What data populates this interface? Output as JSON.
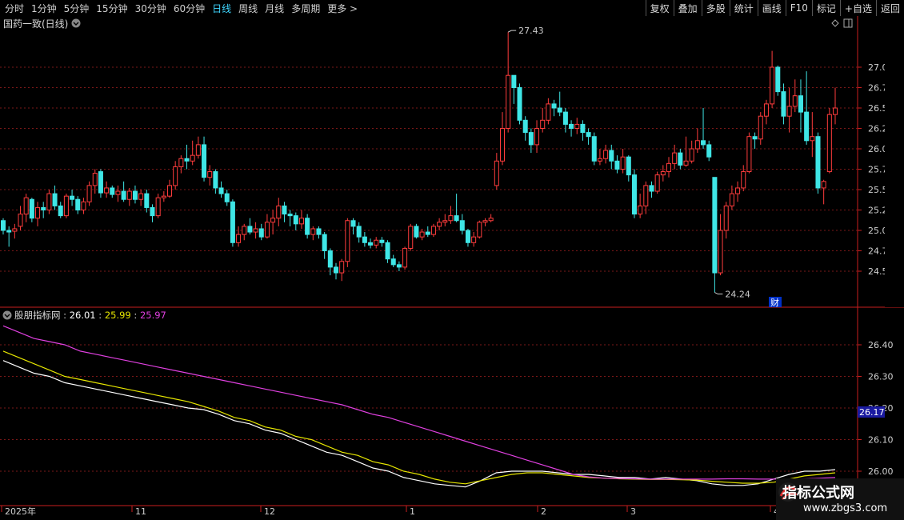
{
  "toolbar": {
    "periods": [
      "分时",
      "1分钟",
      "5分钟",
      "15分钟",
      "30分钟",
      "60分钟",
      "日线",
      "周线",
      "月线",
      "多周期",
      "更多 >"
    ],
    "active_period": "日线",
    "actions": [
      "复权",
      "叠加",
      "多股",
      "统计",
      "画线",
      "F10",
      "标记",
      "+自选",
      "返回"
    ]
  },
  "main_title": "国药一致(日线)",
  "indicator": {
    "name": "股朋指标网",
    "v1": "26.01",
    "v2": "25.99",
    "v3": "25.97",
    "sep": " : "
  },
  "annotations": {
    "high": "27.43",
    "low": "24.24",
    "cai": "财",
    "last_value": "26.17"
  },
  "x_axis_labels": [
    "2025年",
    "11",
    "12",
    "1",
    "2",
    "3",
    "4"
  ],
  "price_axis": [
    "27.00",
    "26.75",
    "26.50",
    "26.25",
    "26.00",
    "25.75",
    "25.50",
    "25.25",
    "25.00",
    "24.75",
    "24.50"
  ],
  "indicator_axis": [
    "26.40",
    "26.30",
    "26.20",
    "26.10",
    "26.00"
  ],
  "colors": {
    "up": "#ff3c3c",
    "down": "#3fe6e6",
    "line_white": "#ffffff",
    "line_yellow": "#e6e600",
    "line_magenta": "#e040e0",
    "grid": "#8b1c1c",
    "axis": "#c81e1e"
  },
  "watermark": {
    "title": "指标公式网",
    "url": "www.zbgs3.com"
  },
  "chart_data": {
    "type": "candlestick",
    "candles": [
      [
        25.12,
        25.0,
        25.15,
        24.95
      ],
      [
        25.0,
        24.98,
        25.05,
        24.8
      ],
      [
        24.99,
        25.02,
        25.08,
        24.9
      ],
      [
        25.05,
        25.2,
        25.3,
        25.0
      ],
      [
        25.2,
        25.4,
        25.45,
        25.1
      ],
      [
        25.38,
        25.15,
        25.4,
        25.1
      ],
      [
        25.15,
        25.28,
        25.35,
        25.05
      ],
      [
        25.28,
        25.25,
        25.35,
        25.15
      ],
      [
        25.25,
        25.45,
        25.5,
        25.2
      ],
      [
        25.45,
        25.3,
        25.55,
        25.25
      ],
      [
        25.3,
        25.18,
        25.35,
        25.15
      ],
      [
        25.18,
        25.42,
        25.45,
        25.15
      ],
      [
        25.42,
        25.38,
        25.5,
        25.3
      ],
      [
        25.38,
        25.25,
        25.42,
        25.2
      ],
      [
        25.25,
        25.35,
        25.4,
        25.2
      ],
      [
        25.35,
        25.55,
        25.6,
        25.3
      ],
      [
        25.55,
        25.7,
        25.75,
        25.45
      ],
      [
        25.72,
        25.46,
        25.75,
        25.4
      ],
      [
        25.46,
        25.52,
        25.6,
        25.4
      ],
      [
        25.52,
        25.44,
        25.55,
        25.4
      ],
      [
        25.44,
        25.48,
        25.55,
        25.35
      ],
      [
        25.48,
        25.38,
        25.6,
        25.35
      ],
      [
        25.38,
        25.48,
        25.52,
        25.3
      ],
      [
        25.48,
        25.38,
        25.55,
        25.33
      ],
      [
        25.38,
        25.45,
        25.5,
        25.3
      ],
      [
        25.45,
        25.28,
        25.5,
        25.22
      ],
      [
        25.28,
        25.18,
        25.32,
        25.1
      ],
      [
        25.18,
        25.4,
        25.45,
        25.15
      ],
      [
        25.4,
        25.42,
        25.48,
        25.35
      ],
      [
        25.42,
        25.55,
        25.62,
        25.4
      ],
      [
        25.55,
        25.78,
        25.85,
        25.5
      ],
      [
        25.78,
        25.88,
        25.92,
        25.7
      ],
      [
        25.88,
        25.85,
        26.05,
        25.75
      ],
      [
        25.85,
        25.92,
        26.1,
        25.8
      ],
      [
        25.92,
        26.05,
        26.15,
        25.88
      ],
      [
        26.05,
        25.65,
        26.15,
        25.6
      ],
      [
        25.65,
        25.72,
        25.8,
        25.55
      ],
      [
        25.72,
        25.52,
        25.75,
        25.45
      ],
      [
        25.52,
        25.45,
        25.6,
        25.4
      ],
      [
        25.45,
        25.35,
        25.5,
        25.3
      ],
      [
        25.35,
        24.85,
        25.38,
        24.8
      ],
      [
        24.85,
        24.95,
        25.05,
        24.8
      ],
      [
        24.95,
        25.05,
        25.08,
        24.88
      ],
      [
        25.05,
        24.98,
        25.15,
        24.95
      ],
      [
        24.98,
        25.02,
        25.1,
        24.9
      ],
      [
        25.02,
        24.92,
        25.08,
        24.88
      ],
      [
        24.92,
        25.1,
        25.2,
        24.9
      ],
      [
        25.1,
        25.15,
        25.25,
        24.95
      ],
      [
        25.15,
        25.3,
        25.4,
        25.05
      ],
      [
        25.3,
        25.2,
        25.35,
        25.1
      ],
      [
        25.2,
        25.18,
        25.25,
        25.05
      ],
      [
        25.18,
        25.08,
        25.22,
        25.0
      ],
      [
        25.08,
        25.15,
        25.25,
        25.02
      ],
      [
        25.15,
        24.95,
        25.2,
        24.9
      ],
      [
        24.95,
        25.02,
        25.05,
        24.88
      ],
      [
        25.02,
        24.95,
        25.05,
        24.9
      ],
      [
        24.95,
        24.75,
        24.98,
        24.65
      ],
      [
        24.75,
        24.55,
        24.78,
        24.45
      ],
      [
        24.55,
        24.48,
        24.6,
        24.4
      ],
      [
        24.48,
        24.62,
        24.65,
        24.38
      ],
      [
        24.62,
        25.12,
        25.15,
        24.55
      ],
      [
        25.12,
        25.05,
        25.15,
        24.95
      ],
      [
        25.05,
        24.92,
        25.1,
        24.85
      ],
      [
        24.92,
        24.85,
        24.98,
        24.8
      ],
      [
        24.85,
        24.82,
        24.9,
        24.78
      ],
      [
        24.82,
        24.88,
        24.92,
        24.78
      ],
      [
        24.88,
        24.85,
        24.92,
        24.8
      ],
      [
        24.85,
        24.65,
        24.88,
        24.6
      ],
      [
        24.65,
        24.58,
        24.7,
        24.55
      ],
      [
        24.58,
        24.55,
        24.62,
        24.5
      ],
      [
        24.55,
        24.78,
        24.8,
        24.52
      ],
      [
        24.78,
        25.05,
        25.08,
        24.75
      ],
      [
        25.05,
        24.92,
        25.08,
        24.9
      ],
      [
        24.92,
        24.98,
        25.02,
        24.88
      ],
      [
        24.98,
        24.95,
        25.05,
        24.92
      ],
      [
        24.95,
        25.05,
        25.08,
        24.92
      ],
      [
        25.05,
        25.1,
        25.15,
        25.0
      ],
      [
        25.1,
        25.12,
        25.2,
        25.05
      ],
      [
        25.12,
        25.18,
        25.3,
        25.08
      ],
      [
        25.18,
        25.12,
        25.45,
        25.1
      ],
      [
        25.12,
        25.0,
        25.2,
        24.95
      ],
      [
        25.0,
        24.85,
        25.02,
        24.8
      ],
      [
        24.85,
        24.92,
        24.98,
        24.8
      ],
      [
        24.92,
        25.1,
        25.12,
        24.9
      ],
      [
        25.1,
        25.12,
        25.15,
        25.05
      ],
      [
        25.12,
        25.15,
        25.2,
        25.1
      ],
      [
        25.55,
        25.85,
        25.95,
        25.5
      ],
      [
        25.85,
        26.25,
        26.45,
        25.8
      ],
      [
        26.25,
        26.9,
        27.43,
        26.2
      ],
      [
        26.9,
        26.75,
        26.9,
        26.55
      ],
      [
        26.75,
        26.35,
        26.8,
        26.3
      ],
      [
        26.35,
        26.2,
        26.4,
        26.1
      ],
      [
        26.2,
        26.05,
        26.25,
        25.95
      ],
      [
        26.05,
        26.25,
        26.35,
        25.95
      ],
      [
        26.25,
        26.35,
        26.5,
        26.2
      ],
      [
        26.35,
        26.55,
        26.62,
        26.3
      ],
      [
        26.55,
        26.5,
        26.6,
        26.4
      ],
      [
        26.5,
        26.45,
        26.7,
        26.4
      ],
      [
        26.45,
        26.3,
        26.5,
        26.2
      ],
      [
        26.3,
        26.25,
        26.35,
        26.15
      ],
      [
        26.25,
        26.3,
        26.38,
        26.18
      ],
      [
        26.3,
        26.2,
        26.35,
        26.1
      ],
      [
        26.2,
        26.15,
        26.25,
        26.05
      ],
      [
        26.15,
        25.85,
        26.2,
        25.8
      ],
      [
        25.85,
        25.88,
        26.0,
        25.8
      ],
      [
        25.88,
        25.98,
        26.05,
        25.82
      ],
      [
        25.98,
        25.85,
        26.05,
        25.75
      ],
      [
        25.85,
        25.75,
        25.92,
        25.7
      ],
      [
        25.75,
        25.9,
        26.0,
        25.7
      ],
      [
        25.9,
        25.68,
        25.92,
        25.6
      ],
      [
        25.68,
        25.2,
        25.75,
        25.15
      ],
      [
        25.2,
        25.3,
        25.45,
        25.15
      ],
      [
        25.3,
        25.55,
        25.6,
        25.2
      ],
      [
        25.55,
        25.48,
        25.6,
        25.4
      ],
      [
        25.48,
        25.68,
        25.72,
        25.45
      ],
      [
        25.68,
        25.72,
        25.8,
        25.6
      ],
      [
        25.72,
        25.82,
        25.9,
        25.65
      ],
      [
        25.82,
        25.95,
        26.05,
        25.75
      ],
      [
        25.95,
        25.8,
        26.0,
        25.75
      ],
      [
        25.8,
        25.85,
        26.15,
        25.78
      ],
      [
        25.85,
        26.0,
        26.1,
        25.82
      ],
      [
        26.0,
        26.1,
        26.25,
        25.95
      ],
      [
        26.1,
        26.05,
        26.5,
        26.0
      ],
      [
        26.05,
        25.9,
        26.1,
        25.85
      ],
      [
        25.65,
        24.48,
        25.65,
        24.24
      ],
      [
        24.48,
        25.0,
        25.2,
        24.45
      ],
      [
        25.0,
        25.3,
        25.35,
        24.9
      ],
      [
        25.3,
        25.45,
        25.55,
        25.25
      ],
      [
        25.45,
        25.52,
        25.6,
        25.35
      ],
      [
        25.52,
        25.72,
        25.8,
        25.48
      ],
      [
        25.72,
        26.15,
        26.2,
        25.7
      ],
      [
        26.15,
        26.12,
        26.2,
        26.0
      ],
      [
        26.12,
        26.4,
        26.45,
        26.05
      ],
      [
        26.4,
        26.55,
        26.6,
        26.3
      ],
      [
        26.55,
        27.0,
        27.2,
        26.5
      ],
      [
        27.0,
        26.7,
        27.02,
        26.65
      ],
      [
        26.7,
        26.4,
        26.8,
        26.3
      ],
      [
        26.4,
        26.52,
        26.75,
        26.2
      ],
      [
        26.52,
        26.65,
        26.85,
        26.45
      ],
      [
        26.65,
        26.45,
        26.85,
        26.2
      ],
      [
        26.45,
        26.1,
        26.95,
        26.05
      ],
      [
        26.1,
        26.15,
        26.45,
        25.9
      ],
      [
        26.15,
        25.52,
        26.2,
        25.45
      ],
      [
        25.52,
        25.6,
        25.62,
        25.32
      ],
      [
        25.72,
        26.42,
        26.5,
        25.7
      ],
      [
        26.42,
        26.5,
        26.75,
        26.3
      ]
    ],
    "y_min": 24.24,
    "y_max": 27.43,
    "indicator_series": [
      {
        "name": "white",
        "values": [
          26.35,
          26.33,
          26.31,
          26.3,
          26.28,
          26.27,
          26.26,
          26.25,
          26.24,
          26.23,
          26.22,
          26.21,
          26.2,
          26.195,
          26.18,
          26.16,
          26.15,
          26.13,
          26.12,
          26.1,
          26.08,
          26.06,
          26.05,
          26.03,
          26.01,
          26.0,
          25.98,
          25.97,
          25.96,
          25.955,
          25.95,
          25.97,
          25.995,
          26.0,
          26.0,
          26.0,
          25.995,
          25.99,
          25.99,
          25.985,
          25.98,
          25.98,
          25.975,
          25.98,
          25.975,
          25.97,
          25.96,
          25.955,
          25.955,
          25.96,
          25.975,
          25.99,
          26.0,
          26.0,
          26.005
        ]
      },
      {
        "name": "yellow",
        "values": [
          26.38,
          26.36,
          26.34,
          26.32,
          26.3,
          26.29,
          26.28,
          26.27,
          26.26,
          26.25,
          26.24,
          26.23,
          26.22,
          26.205,
          26.19,
          26.17,
          26.16,
          26.14,
          26.13,
          26.11,
          26.1,
          26.08,
          26.06,
          26.05,
          26.03,
          26.02,
          26.0,
          25.99,
          25.975,
          25.965,
          25.96,
          25.97,
          25.98,
          25.99,
          25.995,
          25.995,
          25.99,
          25.985,
          25.98,
          25.978,
          25.976,
          25.975,
          25.974,
          25.974,
          25.973,
          25.972,
          25.968,
          25.965,
          25.962,
          25.962,
          25.965,
          25.975,
          25.985,
          25.99,
          25.995
        ]
      },
      {
        "name": "magenta",
        "values": [
          26.46,
          26.44,
          26.42,
          26.41,
          26.4,
          26.38,
          26.37,
          26.36,
          26.35,
          26.34,
          26.33,
          26.32,
          26.31,
          26.3,
          26.29,
          26.28,
          26.27,
          26.26,
          26.25,
          26.24,
          26.23,
          26.22,
          26.21,
          26.195,
          26.18,
          26.17,
          26.155,
          26.14,
          26.125,
          26.11,
          26.095,
          26.08,
          26.065,
          26.05,
          26.035,
          26.02,
          26.005,
          25.99,
          25.982,
          25.978,
          25.977,
          25.976,
          25.975,
          25.975,
          25.975,
          25.975,
          25.975,
          25.976,
          25.976,
          25.975,
          25.975,
          25.975,
          25.976,
          25.978,
          25.98
        ]
      }
    ]
  }
}
